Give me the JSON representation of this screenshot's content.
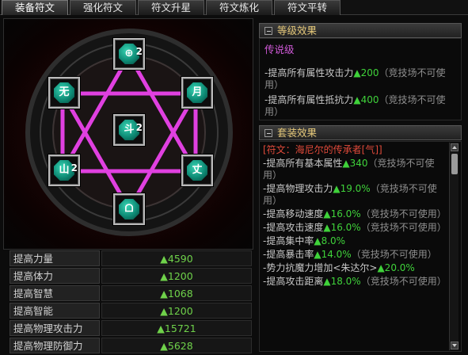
{
  "tabs": [
    {
      "label": "装备符文",
      "active": true
    },
    {
      "label": "强化符文",
      "active": false
    },
    {
      "label": "符文升星",
      "active": false
    },
    {
      "label": "符文炼化",
      "active": false
    },
    {
      "label": "符文平转",
      "active": false
    }
  ],
  "rune_slots": {
    "top": {
      "glyph": "⊕",
      "count": "2"
    },
    "left": {
      "glyph": "无",
      "count": ""
    },
    "right": {
      "glyph": "月",
      "count": ""
    },
    "center": {
      "glyph": "斗",
      "count": "2"
    },
    "lower_left": {
      "glyph": "山",
      "count": "2"
    },
    "lower_right": {
      "glyph": "丈",
      "count": ""
    },
    "bottom": {
      "glyph": "ᗝ",
      "count": ""
    }
  },
  "stats": [
    {
      "label": "提高力量",
      "value": "▲4590"
    },
    {
      "label": "提高体力",
      "value": "▲1200"
    },
    {
      "label": "提高智慧",
      "value": "▲1068"
    },
    {
      "label": "提高智能",
      "value": "▲1200"
    },
    {
      "label": "提高物理攻击力",
      "value": "▲15721"
    },
    {
      "label": "提高物理防御力",
      "value": "▲5628"
    }
  ],
  "grade_panel": {
    "title": "等级效果",
    "grade": "传说级",
    "lines": [
      {
        "text": "-提高所有属性攻击力",
        "value": "▲200",
        "note": "（竞技场不可使用）"
      },
      {
        "text": "-提高所有属性抵抗力",
        "value": "▲400",
        "note": "（竞技场不可使用）"
      }
    ]
  },
  "set_panel": {
    "title": "套装效果",
    "set_name": "[符文：海尼尔的传承者[气]]",
    "lines": [
      {
        "text": "-提高所有基本属性",
        "value": "▲340",
        "note": "（竞技场不可使用）"
      },
      {
        "text": "-提高物理攻击力",
        "value": "▲19.0%",
        "note": "（竞技场不可使用）"
      },
      {
        "text": "-提高移动速度",
        "value": "▲16.0%",
        "note": "（竞技场不可使用）"
      },
      {
        "text": "-提高攻击速度",
        "value": "▲16.0%",
        "note": "（竞技场不可使用）"
      },
      {
        "text": "-提高集中率",
        "value": "▲8.0%",
        "note": ""
      },
      {
        "text": "-提高暴击率",
        "value": "▲14.0%",
        "note": "（竞技场不可使用）"
      },
      {
        "text": "-势力抗魔力增加<朱达尔>",
        "value": "▲20.0%",
        "note": ""
      },
      {
        "text": "-提高攻击距离",
        "value": "▲18.0%",
        "note": "（竞技场不可使用）"
      }
    ]
  },
  "colors": {
    "accent_up": "#3fd23a",
    "grade_purple": "#d05ad8",
    "set_red": "#e04a3a",
    "hexagram": "#e040e0"
  }
}
